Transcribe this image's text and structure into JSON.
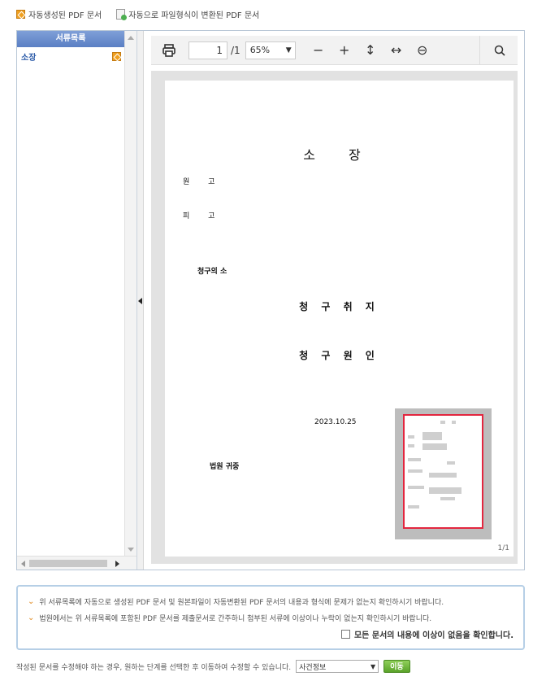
{
  "legend": {
    "auto_label": "자동생성된 PDF 문서",
    "converted_label": "자동으로 파일형식이 변환된 PDF 문서"
  },
  "sidebar": {
    "header": "서류목록",
    "items": [
      {
        "label": "소장"
      }
    ]
  },
  "toolbar": {
    "page_current": "1",
    "page_total": "/1",
    "zoom": "65%",
    "icons": [
      "print-icon",
      "minus-icon",
      "plus-icon",
      "fit-height-icon",
      "fit-width-icon",
      "more-icon",
      "search-icon"
    ]
  },
  "document": {
    "title": "소 장",
    "plaintiff_label": "원 고",
    "defendant_label": "피 고",
    "claim_label": "청구의 소",
    "purpose_heading": "청 구 취 지",
    "cause_heading": "청 구 원 인",
    "date": "2023.10.25",
    "court": "법원 귀중",
    "page_indicator": "1/1"
  },
  "notice": {
    "line1": "위 서류목록에 자동으로 생성된 PDF 문서 및 원본파일이 자동변환된 PDF 문서의 내용과 형식에 문제가 없는지 확인하시기 바랍니다.",
    "line2": "법원에서는 위 서류목록에 포함된 PDF 문서를 제출문서로 간주하니 첨부된 서류에 이상이나 누락이 없는지 확인하시기 바랍니다.",
    "confirm": "모든 문서의 내용에 이상이 없음을 확인합니다."
  },
  "bottom": {
    "text": "작성된 문서를 수정해야 하는 경우, 원하는 단계를 선택한 후 이동하여 수정할 수 있습니다.",
    "select_value": "사건정보",
    "go_button": "이동"
  },
  "colors": {
    "accent": "#5a7fc4",
    "highlight": "#e3263f",
    "go": "#5aa32a"
  }
}
